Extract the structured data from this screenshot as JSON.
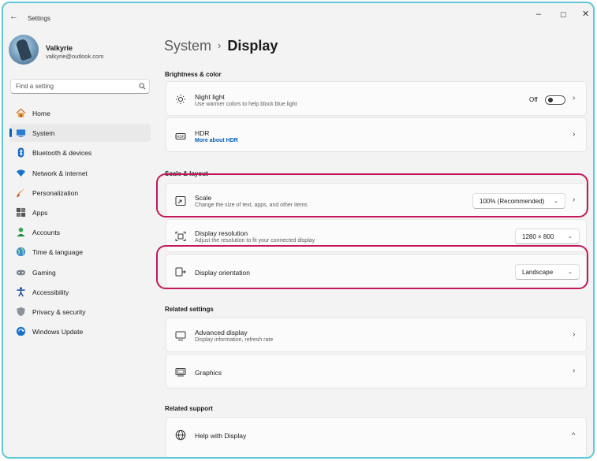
{
  "window": {
    "app_title": "Settings",
    "controls": {
      "back": "←",
      "minimize": "–",
      "maximize": "☐",
      "close": "✕"
    }
  },
  "profile": {
    "name": "Valkyrie",
    "email": "valkyrie@outlook.com"
  },
  "search": {
    "placeholder": "Find a setting"
  },
  "sidebar": {
    "items": [
      {
        "label": "Home",
        "icon": "home-icon",
        "active": false
      },
      {
        "label": "System",
        "icon": "system-icon",
        "active": true
      },
      {
        "label": "Bluetooth & devices",
        "icon": "bluetooth-icon",
        "active": false
      },
      {
        "label": "Network & internet",
        "icon": "network-icon",
        "active": false
      },
      {
        "label": "Personalization",
        "icon": "personalization-icon",
        "active": false
      },
      {
        "label": "Apps",
        "icon": "apps-icon",
        "active": false
      },
      {
        "label": "Accounts",
        "icon": "accounts-icon",
        "active": false
      },
      {
        "label": "Time & language",
        "icon": "time-language-icon",
        "active": false
      },
      {
        "label": "Gaming",
        "icon": "gaming-icon",
        "active": false
      },
      {
        "label": "Accessibility",
        "icon": "accessibility-icon",
        "active": false
      },
      {
        "label": "Privacy & security",
        "icon": "privacy-icon",
        "active": false
      },
      {
        "label": "Windows Update",
        "icon": "windows-update-icon",
        "active": false
      }
    ]
  },
  "breadcrumb": {
    "parent": "System",
    "separator": "›",
    "current": "Display"
  },
  "sections": {
    "brightness": "Brightness & color",
    "scale_layout": "Scale & layout",
    "related_settings": "Related settings",
    "related_support": "Related support"
  },
  "cards": {
    "night_light": {
      "title": "Night light",
      "desc": "Use warmer colors to help block blue light",
      "state": "Off"
    },
    "hdr": {
      "title": "HDR",
      "link": "More about HDR"
    },
    "scale": {
      "title": "Scale",
      "desc": "Change the size of text, apps, and other items",
      "value": "100% (Recommended)"
    },
    "resolution": {
      "title": "Display resolution",
      "desc": "Adjust the resolution to fit your connected display",
      "value": "1280 × 800"
    },
    "orientation": {
      "title": "Display orientation",
      "value": "Landscape"
    },
    "advanced": {
      "title": "Advanced display",
      "desc": "Display information, refresh rate"
    },
    "graphics": {
      "title": "Graphics"
    },
    "help": {
      "title": "Help with Display"
    }
  },
  "glyphs": {
    "chevron_right": "›",
    "chevron_down": "⌄",
    "chevron_up": "^"
  },
  "colors": {
    "accent": "#005fb8",
    "highlight": "#c2185b",
    "window_border": "#5fc8d8"
  }
}
